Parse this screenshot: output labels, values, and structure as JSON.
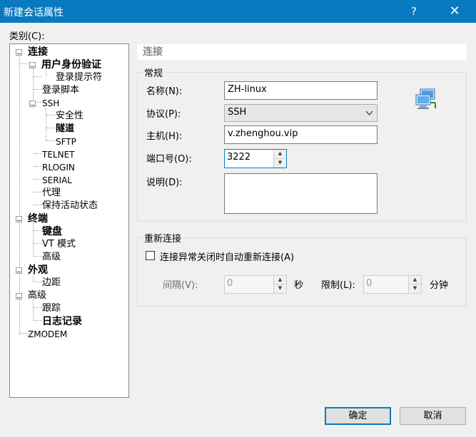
{
  "window": {
    "title": "新建会话属性",
    "help": "?",
    "close": "✕"
  },
  "category_label": "类别(C):",
  "tree": {
    "connection": "连接",
    "auth": "用户身份验证",
    "login_prompt": "登录提示符",
    "login_script": "登录脚本",
    "ssh": "SSH",
    "security": "安全性",
    "tunnel": "隧道",
    "sftp": "SFTP",
    "telnet": "TELNET",
    "rlogin": "RLOGIN",
    "serial": "SERIAL",
    "proxy": "代理",
    "keepalive": "保持活动状态",
    "terminal": "终端",
    "keyboard": "键盘",
    "vt_mode": "VT 模式",
    "term_advanced": "高级",
    "appearance": "外观",
    "margin": "边距",
    "advanced": "高级",
    "trace": "跟踪",
    "logging": "日志记录",
    "zmodem": "ZMODEM",
    "expander_open": "−"
  },
  "section_title": "连接",
  "general": {
    "legend": "常规",
    "name_label": "名称(N):",
    "name_value": "ZH-linux",
    "protocol_label": "协议(P):",
    "protocol_value": "SSH",
    "host_label": "主机(H):",
    "host_value": "v.zhenghou.vip",
    "port_label": "端口号(O):",
    "port_value": "3222",
    "desc_label": "说明(D):",
    "desc_value": ""
  },
  "reconnect": {
    "legend": "重新连接",
    "auto_label": "连接异常关闭时自动重新连接(A)",
    "auto_checked": false,
    "interval_label": "间隔(V):",
    "interval_value": "0",
    "interval_unit": "秒",
    "limit_label": "限制(L):",
    "limit_value": "0",
    "limit_unit": "分钟"
  },
  "buttons": {
    "ok": "确定",
    "cancel": "取消"
  },
  "colors": {
    "titlebar": "#0a7ac0",
    "focus_border": "#0a7ac0"
  }
}
